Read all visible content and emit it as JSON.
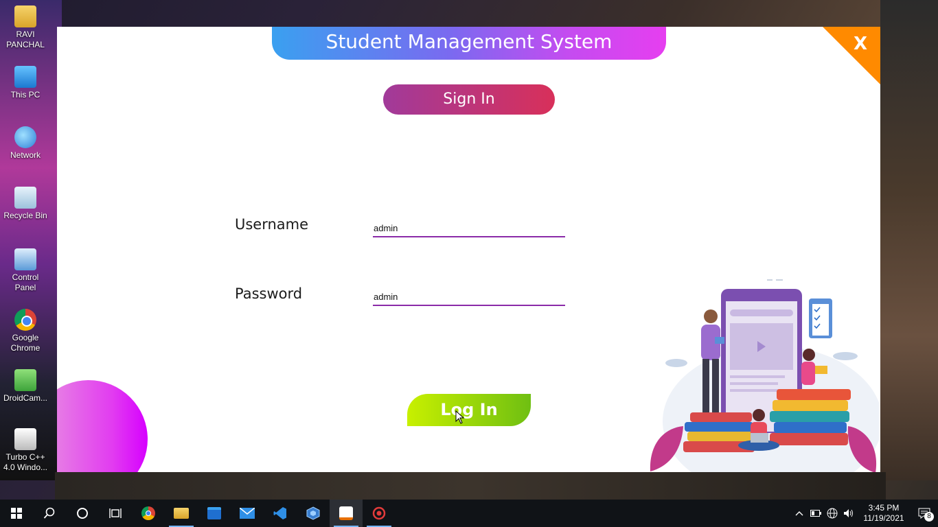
{
  "desktop": {
    "icons": [
      {
        "label": "RAVI PANCHAL"
      },
      {
        "label": "This PC"
      },
      {
        "label": "Network"
      },
      {
        "label": "Recycle Bin"
      },
      {
        "label": "Control Panel"
      },
      {
        "label": "Google Chrome"
      },
      {
        "label": "DroidCam..."
      },
      {
        "label": "Turbo C++ 4.0 Windo..."
      }
    ]
  },
  "app": {
    "title": "Student Management System",
    "close_label": "X",
    "signin_heading": "Sign In",
    "username_label": "Username",
    "username_value": "admin",
    "password_label": "Password",
    "password_value": "admin",
    "login_label": "Log In",
    "colors": {
      "title_gradient": [
        "#3aa0f0",
        "#e63ef0"
      ],
      "signin_gradient": [
        "#a13a9a",
        "#d8305a"
      ],
      "login_gradient": [
        "#c8f000",
        "#6fbf12"
      ],
      "input_underline": "#8a2aa8",
      "close_corner": "#ff8a00"
    }
  },
  "taskbar": {
    "apps": [
      "start-icon",
      "search-icon",
      "cortana-icon",
      "task-view-icon",
      "chrome-icon",
      "file-explorer-icon",
      "store-icon",
      "mail-icon",
      "vscode-icon",
      "virtualbox-icon",
      "java-icon",
      "screen-recorder-icon"
    ],
    "time": "3:45 PM",
    "date": "11/19/2021",
    "notification_count": "8"
  }
}
